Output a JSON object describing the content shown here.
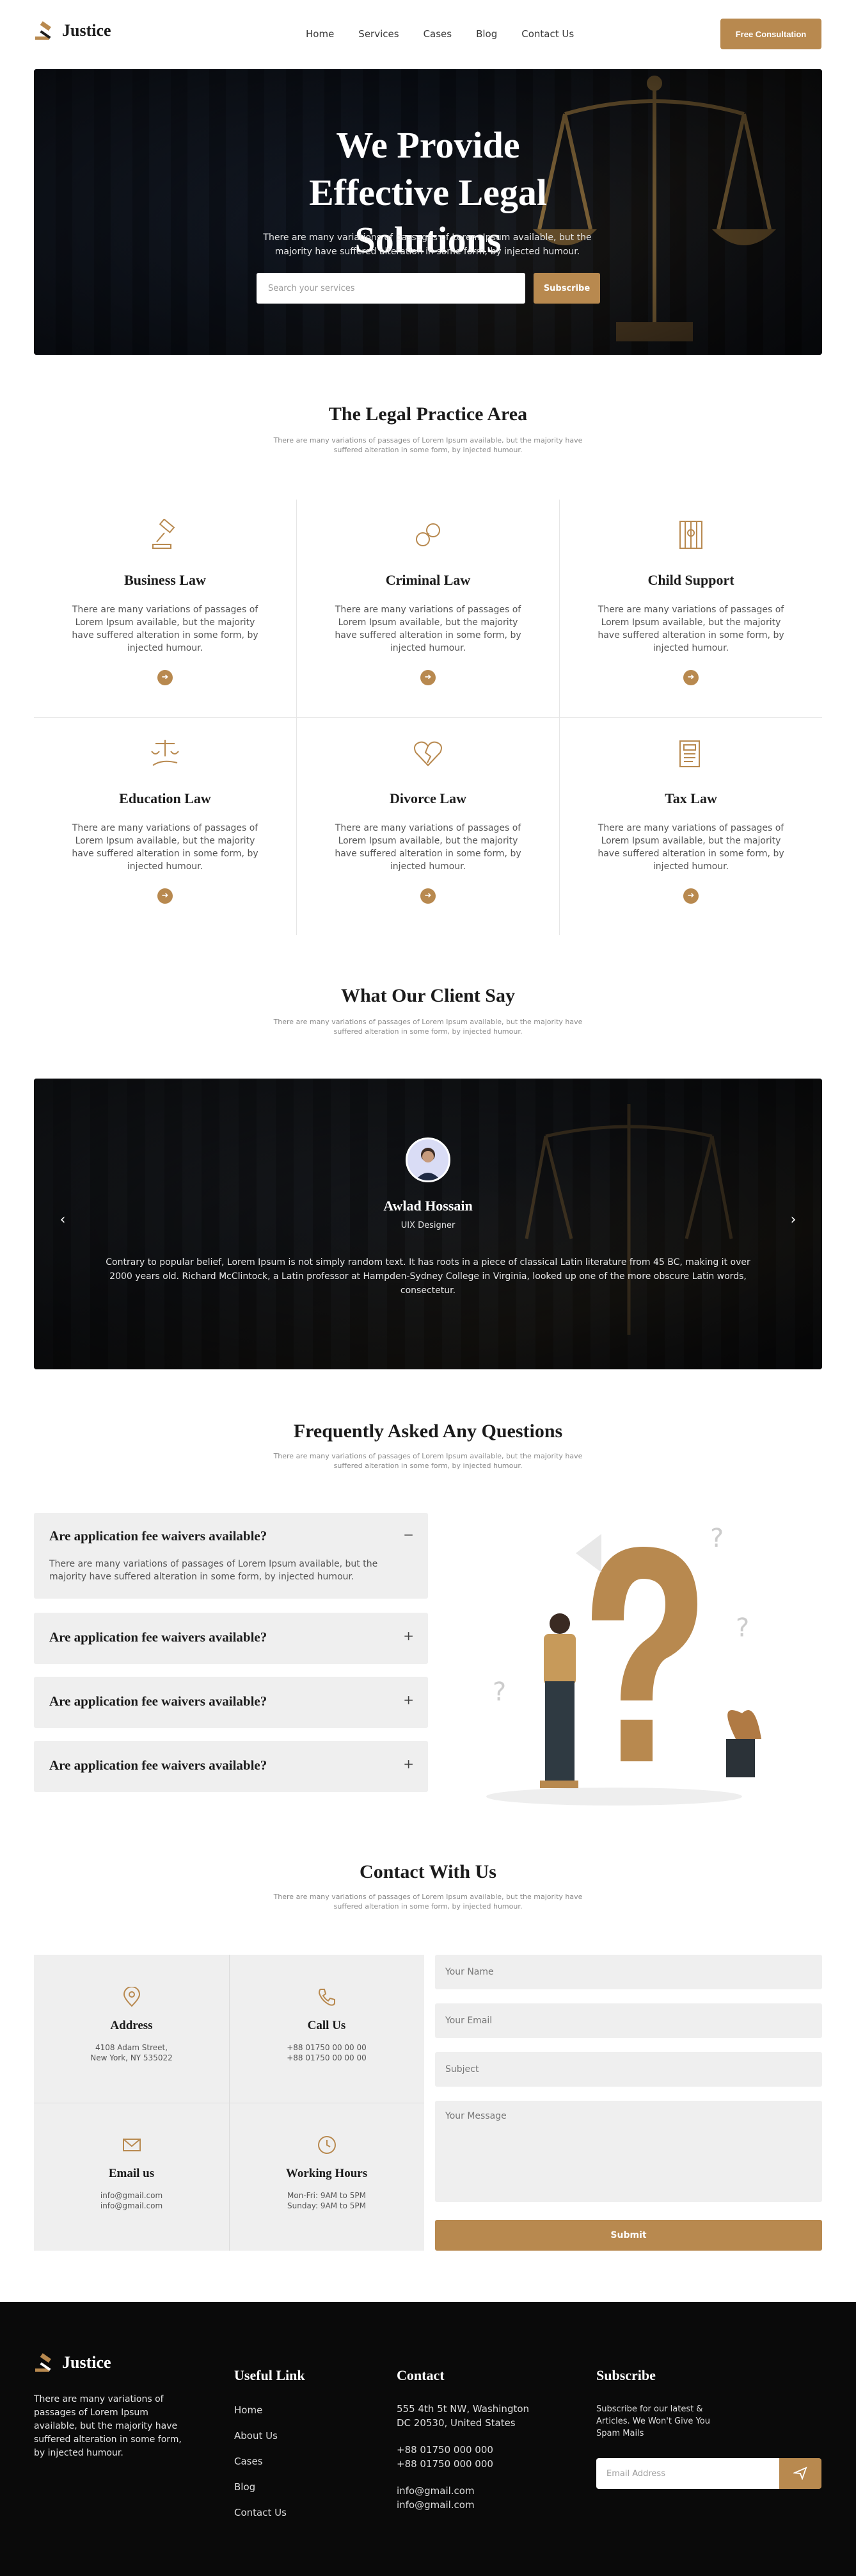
{
  "header": {
    "brand": "Justice",
    "nav": [
      "Home",
      "Services",
      "Cases",
      "Blog",
      "Contact Us"
    ],
    "cta": "Free Consultation"
  },
  "hero": {
    "title": "We Provide Effective Legal Solutions",
    "text": "There are many variations of passages of Lorem Ipsum available, but the majority have suffered alteration in some form, by injected humour.",
    "search_placeholder": "Search your services",
    "subscribe": "Subscribe"
  },
  "practice": {
    "title": "The Legal Practice Area",
    "subtitle": "There are many variations of passages of Lorem Ipsum available, but the majority have suffered alteration in some form, by injected humour.",
    "items": [
      {
        "title": "Business Law",
        "text": "There are many variations of passages of Lorem Ipsum available, but the majority have suffered alteration in some form, by injected humour.",
        "icon": "gavel-icon"
      },
      {
        "title": "Criminal Law",
        "text": "There are many variations of passages of Lorem Ipsum available, but the majority have suffered alteration in some form, by injected humour.",
        "icon": "handcuffs-icon"
      },
      {
        "title": "Child Support",
        "text": "There are many variations of passages of Lorem Ipsum available, but the majority have suffered alteration in some form, by injected humour.",
        "icon": "jail-icon"
      },
      {
        "title": "Education Law",
        "text": "There are many variations of passages of Lorem Ipsum available, but the majority have suffered alteration in some form, by injected humour.",
        "icon": "scales-hand-icon"
      },
      {
        "title": "Divorce Law",
        "text": "There are many variations of passages of Lorem Ipsum available, but the majority have suffered alteration in some form, by injected humour.",
        "icon": "broken-heart-icon"
      },
      {
        "title": "Tax Law",
        "text": "There are many variations of passages of Lorem Ipsum available, but the majority have suffered alteration in some form, by injected humour.",
        "icon": "tax-document-icon"
      }
    ]
  },
  "testimonial": {
    "title": "What Our Client Say",
    "subtitle": "There are many variations of passages of Lorem Ipsum available, but the majority have suffered alteration in some form, by injected humour.",
    "name": "Awlad Hossain",
    "role": "UIX Designer",
    "quote": "Contrary to popular belief, Lorem Ipsum is not simply random text. It has roots in a piece of classical Latin literature from 45 BC, making it over 2000 years old. Richard McClintock, a Latin professor at Hampden-Sydney College in Virginia, looked up one of the more obscure Latin words, consectetur."
  },
  "faq": {
    "title": "Frequently Asked Any Questions",
    "subtitle": "There are many variations of passages of Lorem Ipsum available, but the majority have suffered alteration in some form, by injected humour.",
    "items": [
      {
        "q": "Are application fee waivers available?",
        "a": "There are many variations of passages of Lorem Ipsum available, but the majority have suffered alteration in some form, by injected humour.",
        "sym": "−"
      },
      {
        "q": "Are application fee waivers available?",
        "sym": "+"
      },
      {
        "q": "Are application fee waivers available?",
        "sym": "+"
      },
      {
        "q": "Are application fee waivers available?",
        "sym": "+"
      }
    ]
  },
  "contact": {
    "title": "Contact With Us",
    "subtitle": "There are many variations of passages of Lorem Ipsum available, but the majority have suffered alteration in some form, by injected humour.",
    "boxes": [
      {
        "title": "Address",
        "l1": "4108 Adam Street,",
        "l2": "New York, NY 535022",
        "icon": "location-pin-icon"
      },
      {
        "title": "Call Us",
        "l1": "+88 01750 00 00 00",
        "l2": "+88 01750 00 00 00",
        "icon": "phone-icon"
      },
      {
        "title": "Email us",
        "l1": "info@gmail.com",
        "l2": "info@gmail.com",
        "icon": "envelope-icon"
      },
      {
        "title": "Working Hours",
        "l1": "Mon-Fri: 9AM to 5PM",
        "l2": "Sunday: 9AM to 5PM",
        "icon": "clock-icon"
      }
    ],
    "form": {
      "name": "Your Name",
      "email": "Your Email",
      "subject": "Subject",
      "message": "Your Message",
      "submit": "Submit"
    }
  },
  "footer": {
    "brand": "Justice",
    "desc": "There are many variations of passages of Lorem Ipsum available, but the majority have suffered alteration in some form, by injected humour.",
    "links_title": "Useful Link",
    "links": [
      "Home",
      "About Us",
      "Cases",
      "Blog",
      "Contact Us"
    ],
    "contact_title": "Contact",
    "address": "555 4th 5t NW, Washington DC 20530, United States",
    "phones": [
      "+88 01750 000 000",
      "+88 01750 000 000"
    ],
    "emails": [
      "info@gmail.com",
      "info@gmail.com"
    ],
    "subscribe_title": "Subscribe",
    "subscribe_desc": "Subscribe for our latest & Articles. We Won't Give You Spam Mails",
    "email_placeholder": "Email Address"
  },
  "colors": {
    "accent": "#b8894f",
    "dark": "#1b1b1b",
    "footer": "#0a0a0a",
    "panel": "#efefef"
  }
}
